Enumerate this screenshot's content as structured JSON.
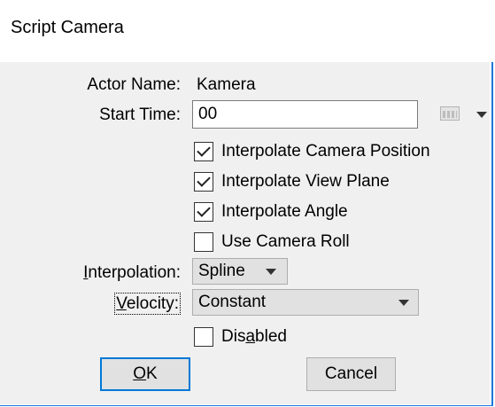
{
  "dialog": {
    "title": "Script Camera"
  },
  "form": {
    "actor_name_label": "Actor Name:",
    "actor_name_value": "Kamera",
    "start_time_label": "Start Time:",
    "start_time_value": "00",
    "checkboxes": [
      {
        "label": "Interpolate Camera Position",
        "checked": true
      },
      {
        "label": "Interpolate View Plane",
        "checked": true
      },
      {
        "label": "Interpolate Angle",
        "checked": true
      },
      {
        "label": "Use Camera Roll",
        "checked": false
      }
    ],
    "interpolation_label_pre": "",
    "interpolation_label_mnemonic": "I",
    "interpolation_label_post": "nterpolation:",
    "interpolation_value": "Spline",
    "velocity_label_pre": "",
    "velocity_label_mnemonic": "V",
    "velocity_label_post": "elocity:",
    "velocity_value": "Constant",
    "disabled_label_pre": "Dis",
    "disabled_label_mnemonic": "a",
    "disabled_label_post": "bled",
    "disabled_checked": false
  },
  "buttons": {
    "ok_mnemonic": "O",
    "ok_rest": "K",
    "cancel_label": "Cancel"
  }
}
